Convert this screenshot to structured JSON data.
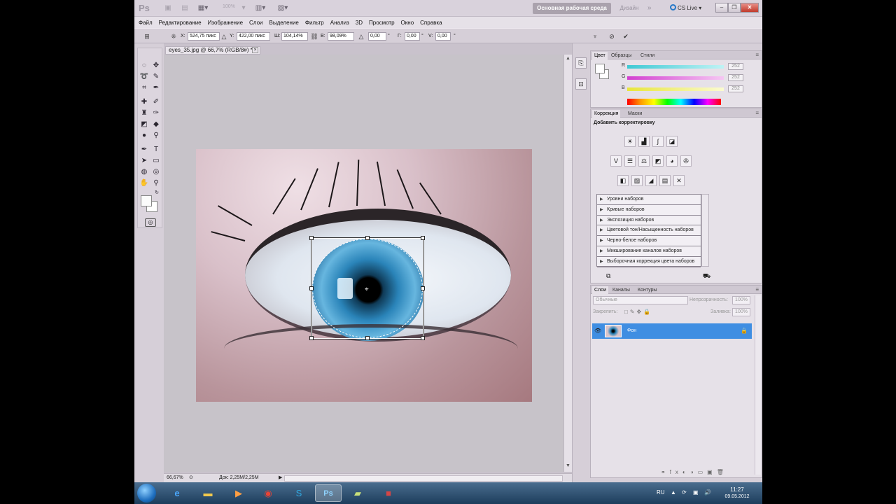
{
  "appbar": {
    "logo": "Ps",
    "zoom": "100%",
    "workspace_active": "Основная рабочая среда",
    "workspace_design": "Дизайн",
    "workspace_more": "»",
    "cs_live": "CS Live"
  },
  "menu": [
    "Файл",
    "Редактирование",
    "Изображение",
    "Слои",
    "Выделение",
    "Фильтр",
    "Анализ",
    "3D",
    "Просмотр",
    "Окно",
    "Справка"
  ],
  "options": {
    "x_label": "X:",
    "x_value": "524,75 пикс",
    "y_label": "Y:",
    "y_value": "422,00 пикс",
    "w_label": "Ш:",
    "w_value": "104,14%",
    "h_label": "В:",
    "h_value": "98,09%",
    "angle_value": "0,00",
    "angle_unit": "°",
    "hskew_label": "Г:",
    "hskew_value": "0,00",
    "vskew_label": "V:",
    "vskew_value": "0,00",
    "hskew_unit": "°",
    "vskew_unit": "°"
  },
  "document": {
    "tab_title": "eyes_35.jpg @ 66,7% (RGB/8#) *",
    "close": "×",
    "zoom": "66,67%",
    "doc_size": "Док: 2,25M/2,25M"
  },
  "color_panel": {
    "tabs": [
      "Цвет",
      "Образцы",
      "Стили"
    ],
    "r_label": "R",
    "g_label": "G",
    "b_label": "B",
    "r_value": "252",
    "g_value": "252",
    "b_value": "252",
    "r_color": "#3ec9d4",
    "g_color": "#d23fd0",
    "b_color": "#e8e63a"
  },
  "adjust_panel": {
    "tabs": [
      "Коррекция",
      "Маски"
    ],
    "heading": "Добавить корректировку",
    "presets": [
      "Уровни наборов",
      "Кривые наборов",
      "Экспозиция наборов",
      "Цветовой тон/Насыщенность наборов",
      "Черно-белое наборов",
      "Микширование каналов наборов",
      "Выборочная коррекция цвета наборов"
    ]
  },
  "layers_panel": {
    "tabs": [
      "Слои",
      "Каналы",
      "Контуры"
    ],
    "blend_mode": "Обычные",
    "opacity_label": "Непрозрачность:",
    "opacity_value": "100%",
    "lock_label": "Закрепить:",
    "fill_label": "Заливка:",
    "fill_value": "100%",
    "layer_name": "Фон",
    "selected_color": "#3f8ee2"
  },
  "taskbar": {
    "lang": "RU",
    "time": "11:27",
    "date": "09.05.2012"
  }
}
